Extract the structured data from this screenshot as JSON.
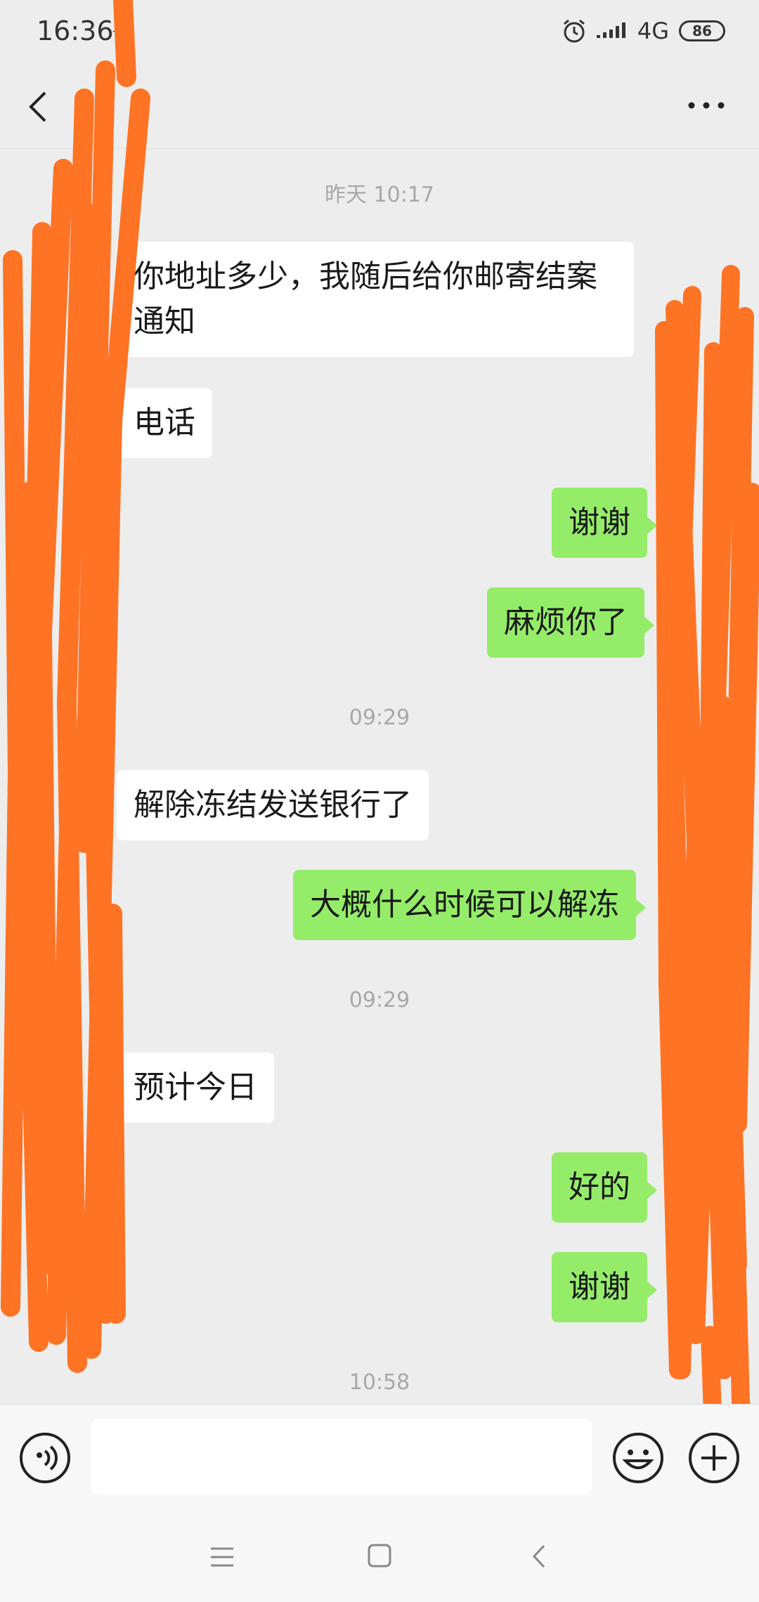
{
  "status": {
    "time": "16:36",
    "network": "4G",
    "battery": "86",
    "icons": [
      "navigation-icon",
      "alarm-icon",
      "signal-icon",
      "battery-icon"
    ]
  },
  "header": {
    "icons": [
      "back-arrow-icon",
      "more-dots-icon"
    ]
  },
  "chat": {
    "t1": "昨天 10:17",
    "m1": "你地址多少，我随后给你邮寄结案通知",
    "m2": "电话",
    "m3": "谢谢",
    "m4": "麻烦你了",
    "t2": "09:29",
    "m5": "解除冻结发送银行了",
    "m6": "大概什么时候可以解冻",
    "t3": "09:29",
    "m7": "预计今日",
    "m8": "好的",
    "m9": "谢谢",
    "t4": "10:58"
  },
  "input": {
    "placeholder": "",
    "icons": [
      "voice-icon",
      "emoji-icon",
      "plus-icon"
    ]
  },
  "system_nav": {
    "icons": [
      "menu-icon",
      "home-icon",
      "back-icon"
    ]
  },
  "colors": {
    "background": "#ededed",
    "bubble_out": "#95ec69",
    "bubble_in": "#ffffff",
    "redaction": "#ff7324"
  }
}
